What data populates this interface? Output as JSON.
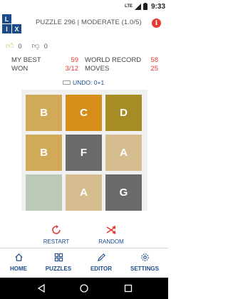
{
  "status_bar": {
    "network": "LTE",
    "time": "9:33"
  },
  "header": {
    "logo_letters": [
      "L",
      "I",
      "X"
    ],
    "title": "PUZZLE 296 | MODERATE (1.0/5)",
    "info_icon": "info-icon"
  },
  "votes": {
    "up_count": "0",
    "down_count": "0"
  },
  "stats": {
    "my_best_label": "MY BEST",
    "my_best_value": "59",
    "world_record_label": "WORLD RECORD",
    "world_record_value": "58",
    "won_label": "WON",
    "won_value": "3/12",
    "moves_label": "MOVES",
    "moves_value": "25"
  },
  "undo": {
    "label": "UNDO: 0+1"
  },
  "board": {
    "tiles": [
      {
        "letter": "B",
        "color": "#d1aa57"
      },
      {
        "letter": "C",
        "color": "#d68e1a"
      },
      {
        "letter": "D",
        "color": "#a68c24"
      },
      {
        "letter": "B",
        "color": "#d1aa57"
      },
      {
        "letter": "F",
        "color": "#6a6a6a"
      },
      {
        "letter": "A",
        "color": "#d5bd8f"
      },
      {
        "letter": "",
        "color": "#bcc9b8"
      },
      {
        "letter": "A",
        "color": "#d5bd8f"
      },
      {
        "letter": "G",
        "color": "#6a6a6a"
      }
    ]
  },
  "actions": {
    "restart": "RESTART",
    "random": "RANDOM"
  },
  "nav": {
    "home": "HOME",
    "puzzles": "PUZZLES",
    "editor": "EDITOR",
    "settings": "SETTINGS"
  },
  "colors": {
    "accent_red": "#e53935",
    "brand_blue": "#1c4b8a"
  }
}
